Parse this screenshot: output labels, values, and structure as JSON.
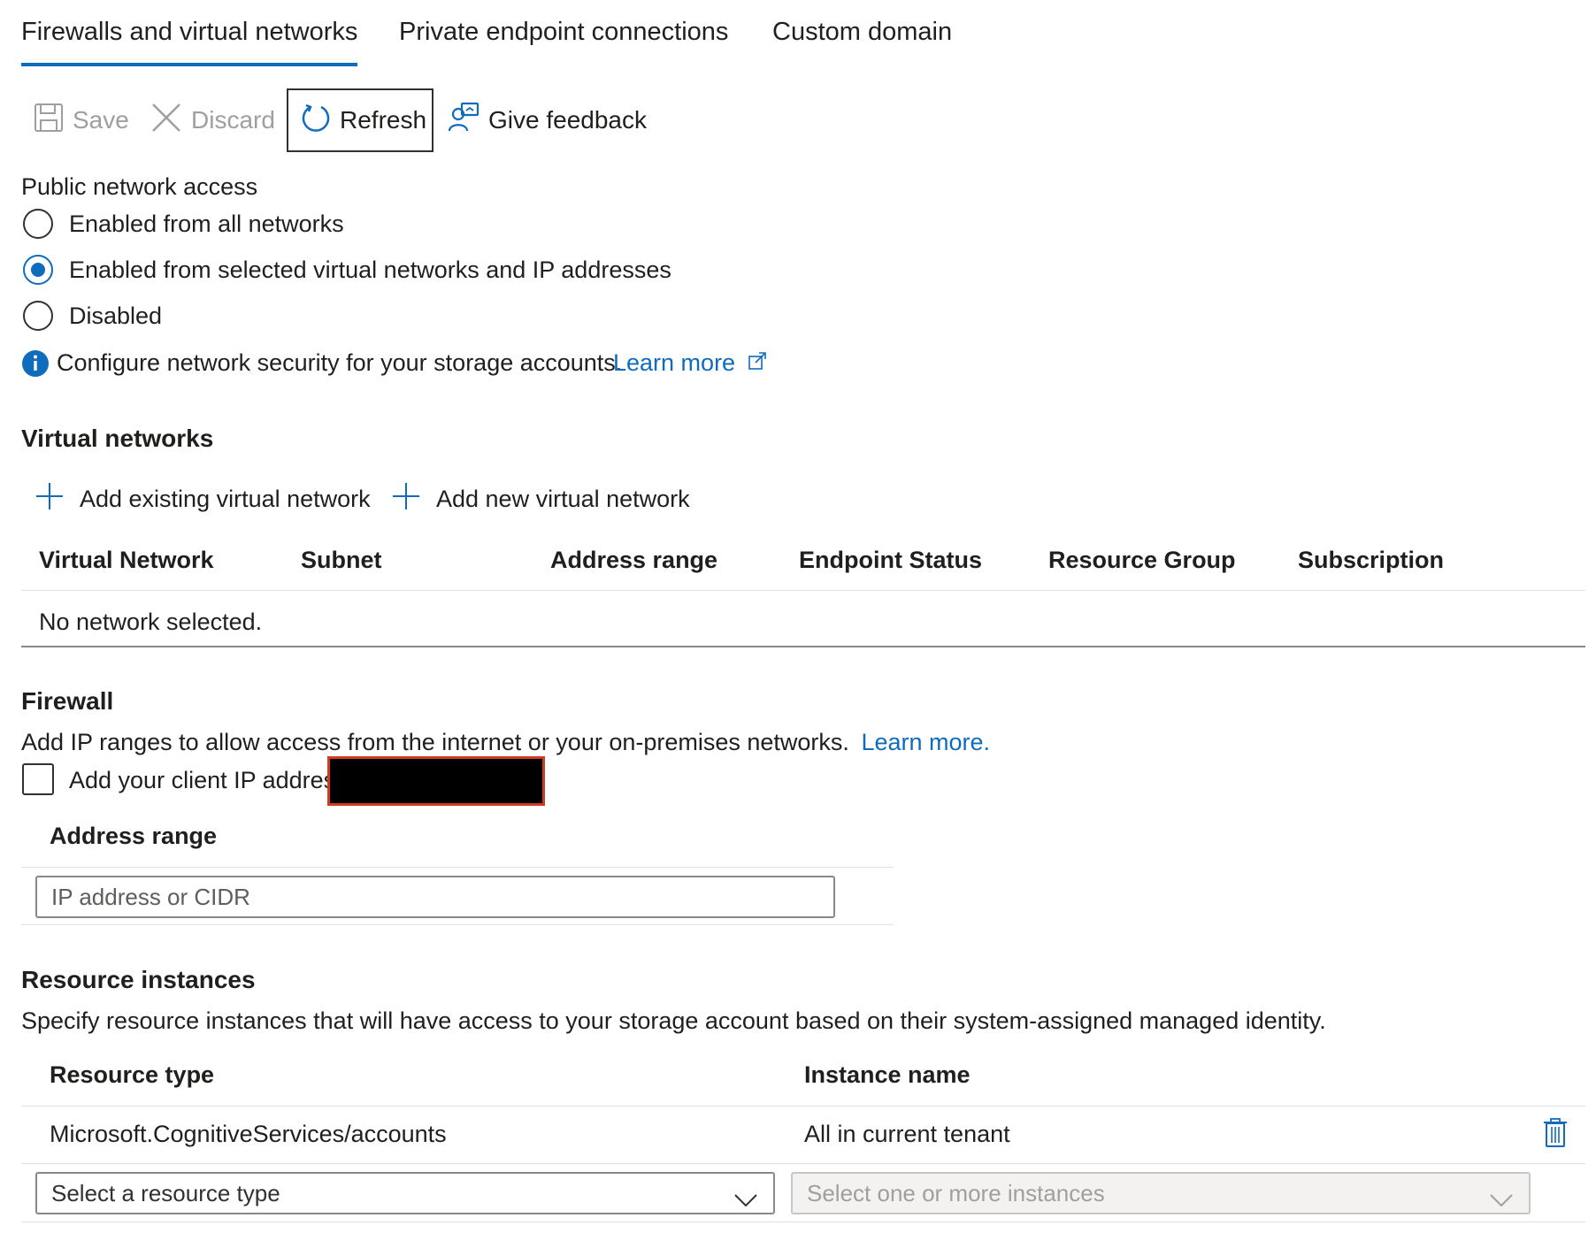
{
  "tabs": [
    {
      "label": "Firewalls and virtual networks",
      "active": true
    },
    {
      "label": "Private endpoint connections",
      "active": false
    },
    {
      "label": "Custom domain",
      "active": false
    }
  ],
  "toolbar": {
    "save_label": "Save",
    "discard_label": "Discard",
    "refresh_label": "Refresh",
    "feedback_label": "Give feedback"
  },
  "public_access": {
    "label": "Public network access",
    "options": [
      {
        "label": "Enabled from all networks",
        "checked": false
      },
      {
        "label": "Enabled from selected virtual networks and IP addresses",
        "checked": true
      },
      {
        "label": "Disabled",
        "checked": false
      }
    ],
    "info_text": "Configure network security for your storage accounts.",
    "learn_more": "Learn more"
  },
  "virtual_networks": {
    "heading": "Virtual networks",
    "add_existing": "Add existing virtual network",
    "add_new": "Add new virtual network",
    "columns": [
      "Virtual Network",
      "Subnet",
      "Address range",
      "Endpoint Status",
      "Resource Group",
      "Subscription"
    ],
    "empty_text": "No network selected."
  },
  "firewall": {
    "heading": "Firewall",
    "description": "Add IP ranges to allow access from the internet or your on-premises networks.",
    "learn_more": "Learn more.",
    "client_ip_label": "Add your client IP addres",
    "address_range_header": "Address range",
    "address_placeholder": "IP address or CIDR"
  },
  "resource_instances": {
    "heading": "Resource instances",
    "description": "Specify resource instances that will have access to your storage account based on their system-assigned managed identity.",
    "columns": [
      "Resource type",
      "Instance name"
    ],
    "rows": [
      {
        "resource_type": "Microsoft.CognitiveServices/accounts",
        "instance_name": "All in current tenant"
      }
    ],
    "resource_type_placeholder": "Select a resource type",
    "instance_placeholder": "Select one or more instances"
  },
  "colors": {
    "accent": "#0f6cbd",
    "redaction_border": "#d13b1f",
    "redaction_fill": "#000000"
  }
}
